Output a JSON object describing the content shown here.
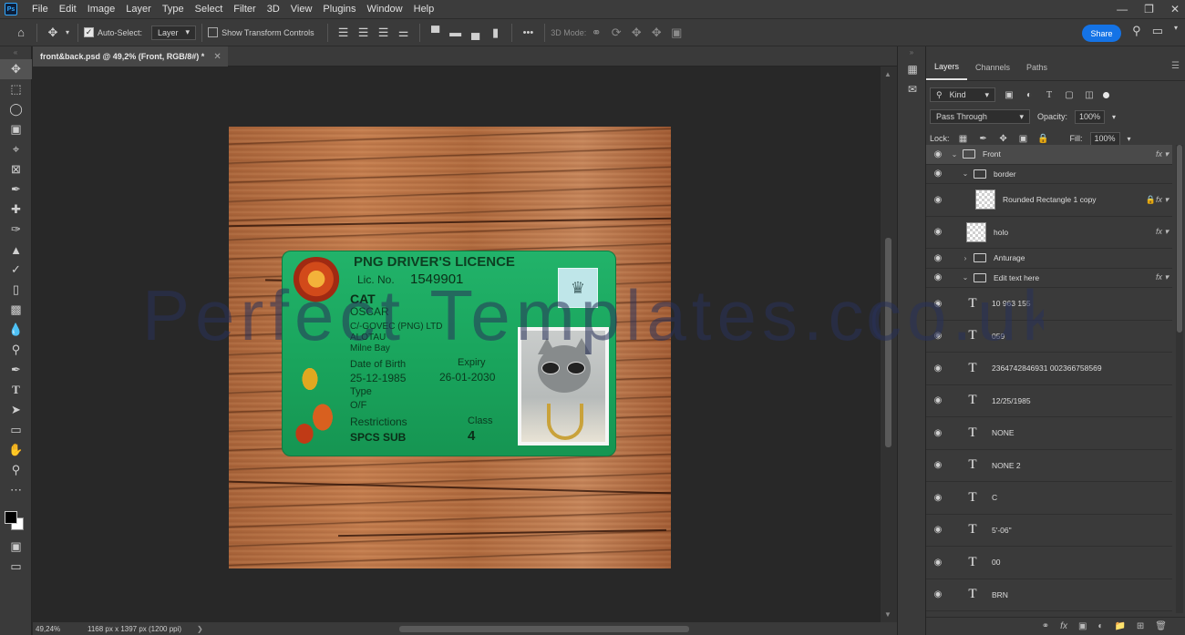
{
  "app": {
    "logo_text": "Ps",
    "menu": [
      "File",
      "Edit",
      "Image",
      "Layer",
      "Type",
      "Select",
      "Filter",
      "3D",
      "View",
      "Plugins",
      "Window",
      "Help"
    ]
  },
  "options_bar": {
    "auto_select_label": "Auto-Select:",
    "auto_select_value": "Layer",
    "show_transform_label": "Show Transform Controls",
    "mode_3d_label": "3D Mode:",
    "share_label": "Share",
    "more_label": "•••"
  },
  "document": {
    "tab_title": "front&back.psd @ 49,2% (Front, RGB/8#) *",
    "zoom": "49,24%",
    "info": "1168 px x 1397 px (1200 ppi)"
  },
  "card": {
    "title": "PNG DRIVER'S LICENCE",
    "lic_label": "Lic. No.",
    "lic_no": "1549901",
    "surname": "CAT",
    "given": "OSCAR",
    "address1": "C/-GOVEC (PNG) LTD",
    "address2": "ALOTAU",
    "address3": "Milne Bay",
    "dob_label": "Date of Birth",
    "dob": "25-12-1985",
    "expiry_label": "Expiry",
    "expiry": "26-01-2030",
    "type_label": "Type",
    "type": "O/F",
    "restrictions_label": "Restrictions",
    "restrictions": "SPCS  SUB",
    "class_label": "Class",
    "class": "4"
  },
  "watermark": "Perfect Templates.co.uk",
  "watermark_ext": "co.uk",
  "layers_panel": {
    "tabs": [
      "Layers",
      "Channels",
      "Paths"
    ],
    "filter_kind": "Kind",
    "blend_mode": "Pass Through",
    "opacity_label": "Opacity:",
    "opacity": "100%",
    "lock_label": "Lock:",
    "fill_label": "Fill:",
    "fill": "100%",
    "layers": [
      {
        "name": "Front",
        "kind": "group"
      },
      {
        "name": "border",
        "kind": "group"
      },
      {
        "name": "Rounded Rectangle 1 copy",
        "kind": "shape"
      },
      {
        "name": "holo",
        "kind": "pixel"
      },
      {
        "name": "Anturage",
        "kind": "group"
      },
      {
        "name": "Edit text here",
        "kind": "group"
      },
      {
        "name": "10 963 155",
        "kind": "text"
      },
      {
        "name": "059",
        "kind": "text"
      },
      {
        "name": "2364742846931 002366758569",
        "kind": "text"
      },
      {
        "name": "12/25/1985",
        "kind": "text"
      },
      {
        "name": "NONE",
        "kind": "text"
      },
      {
        "name": "NONE 2",
        "kind": "text"
      },
      {
        "name": "C",
        "kind": "text"
      },
      {
        "name": "5'-06\"",
        "kind": "text"
      },
      {
        "name": "00",
        "kind": "text"
      },
      {
        "name": "BRN",
        "kind": "text"
      }
    ]
  },
  "colors": {
    "accent": "#1473e6",
    "card_green": "#1ea862",
    "wood": "#b06a3e"
  }
}
